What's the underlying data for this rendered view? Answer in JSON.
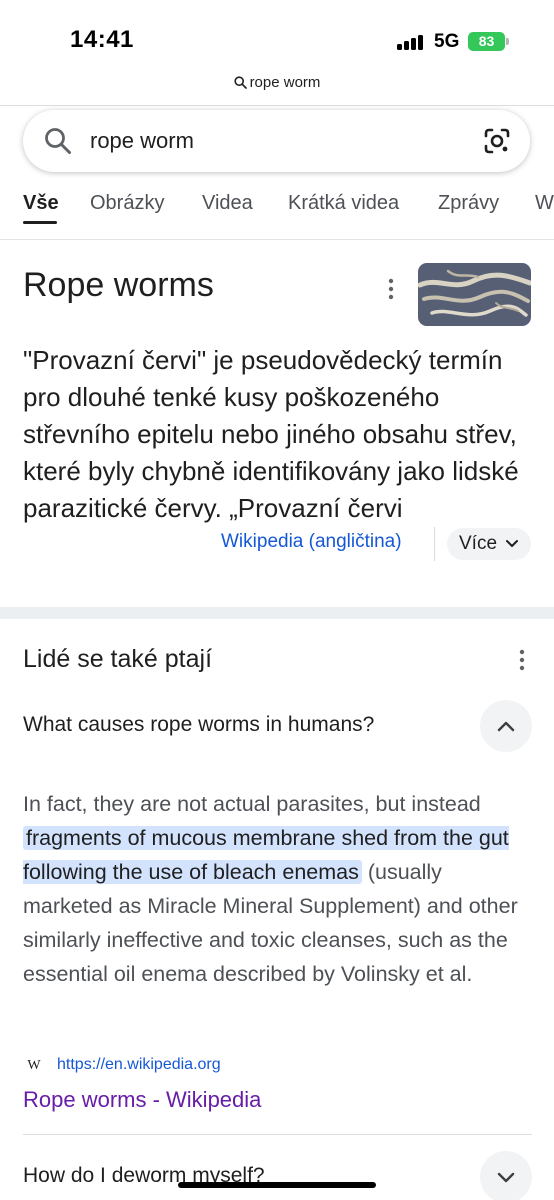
{
  "status_bar": {
    "time": "14:41",
    "network": "5G",
    "battery": "83"
  },
  "browser": {
    "url_text": "rope worm"
  },
  "search": {
    "query": "rope worm"
  },
  "tabs": [
    {
      "label": "Vše",
      "active": true
    },
    {
      "label": "Obrázky",
      "active": false
    },
    {
      "label": "Videa",
      "active": false
    },
    {
      "label": "Krátká videa",
      "active": false
    },
    {
      "label": "Zprávy",
      "active": false
    },
    {
      "label": "W",
      "active": false
    }
  ],
  "knowledge_panel": {
    "title": "Rope worms",
    "description": "\"Provazní červi\" je pseudovědecký termín pro dlouhé tenké kusy poškozeného střevního epitelu nebo jiného obsahu střev, které byly chybně identifikovány jako lidské parazitické červy. „Provazní červi",
    "source_label": "Wikipedia (angličtina)",
    "more_label": "Více"
  },
  "people_also_ask": {
    "title": "Lidé se také ptají",
    "questions": [
      {
        "question": "What causes rope worms in humans?",
        "expanded": true,
        "answer_before": "In fact, they are not actual parasites, but instead ",
        "answer_highlight": "fragments of mucous membrane shed from the gut following the use of bleach enemas",
        "answer_after": " (usually marketed as Miracle Mineral Supplement) and other similarly ineffective and toxic cleanses, such as the essential oil enema described by Volinsky et al.",
        "source_icon": "W",
        "source_url": "https://en.wikipedia.org",
        "source_title": "Rope worms - Wikipedia"
      },
      {
        "question": "How do I deworm myself?",
        "expanded": false
      }
    ]
  },
  "colors": {
    "link_blue": "#1558d6",
    "visited_purple": "#681da8",
    "highlight": "#d3e3fd",
    "battery_green": "#34c759"
  }
}
